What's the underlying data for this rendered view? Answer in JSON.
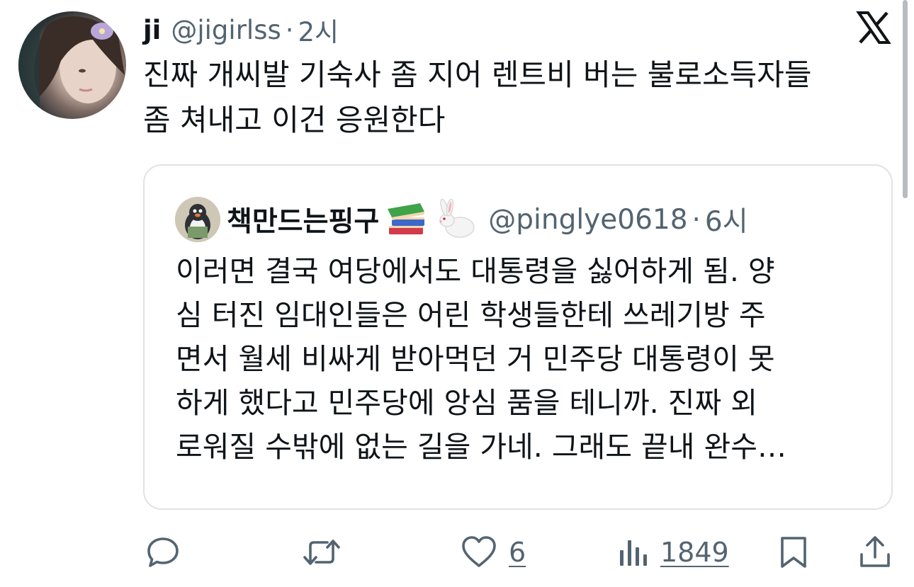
{
  "tweet": {
    "display_name": "ji",
    "handle": "@jigirlss",
    "separator": "·",
    "time": "2시",
    "text_line1": "진짜 개씨발 기숙사 좀 지어 렌트비 버는 불로소득자들",
    "text_line2": "좀 쳐내고 이건 응원한다",
    "avatar_icon": "profile-photo"
  },
  "brand": {
    "logo": "x-logo",
    "logo_color": "#0f1419"
  },
  "quote": {
    "display_name": "책만드는핑구",
    "emoji_icons": [
      "books-emoji",
      "rabbit-emoji"
    ],
    "handle": "@pinglye0618",
    "separator": "·",
    "time": "6시",
    "lines": [
      "이러면 결국 여당에서도 대통령을 싫어하게 됨. 양",
      "심 터진 임대인들은 어린 학생들한테 쓰레기방 주",
      "면서 월세 비싸게 받아먹던 거 민주당 대통령이 못",
      "하게 했다고 민주당에 앙심 품을 테니까. 진짜 외",
      "로워질 수밖에 없는 길을 가네. 그래도 끝내 완수…"
    ]
  },
  "actions": {
    "reply_icon": "reply-icon",
    "retweet_icon": "retweet-icon",
    "like_icon": "heart-icon",
    "like_count": "6",
    "views_icon": "views-icon",
    "views_count": "1849",
    "bookmark_icon": "bookmark-icon",
    "share_icon": "share-icon",
    "icon_color": "#536471"
  },
  "colors": {
    "text_primary": "#0f1419",
    "text_secondary": "#536471",
    "border": "#dfe3e6",
    "background": "#ffffff"
  }
}
